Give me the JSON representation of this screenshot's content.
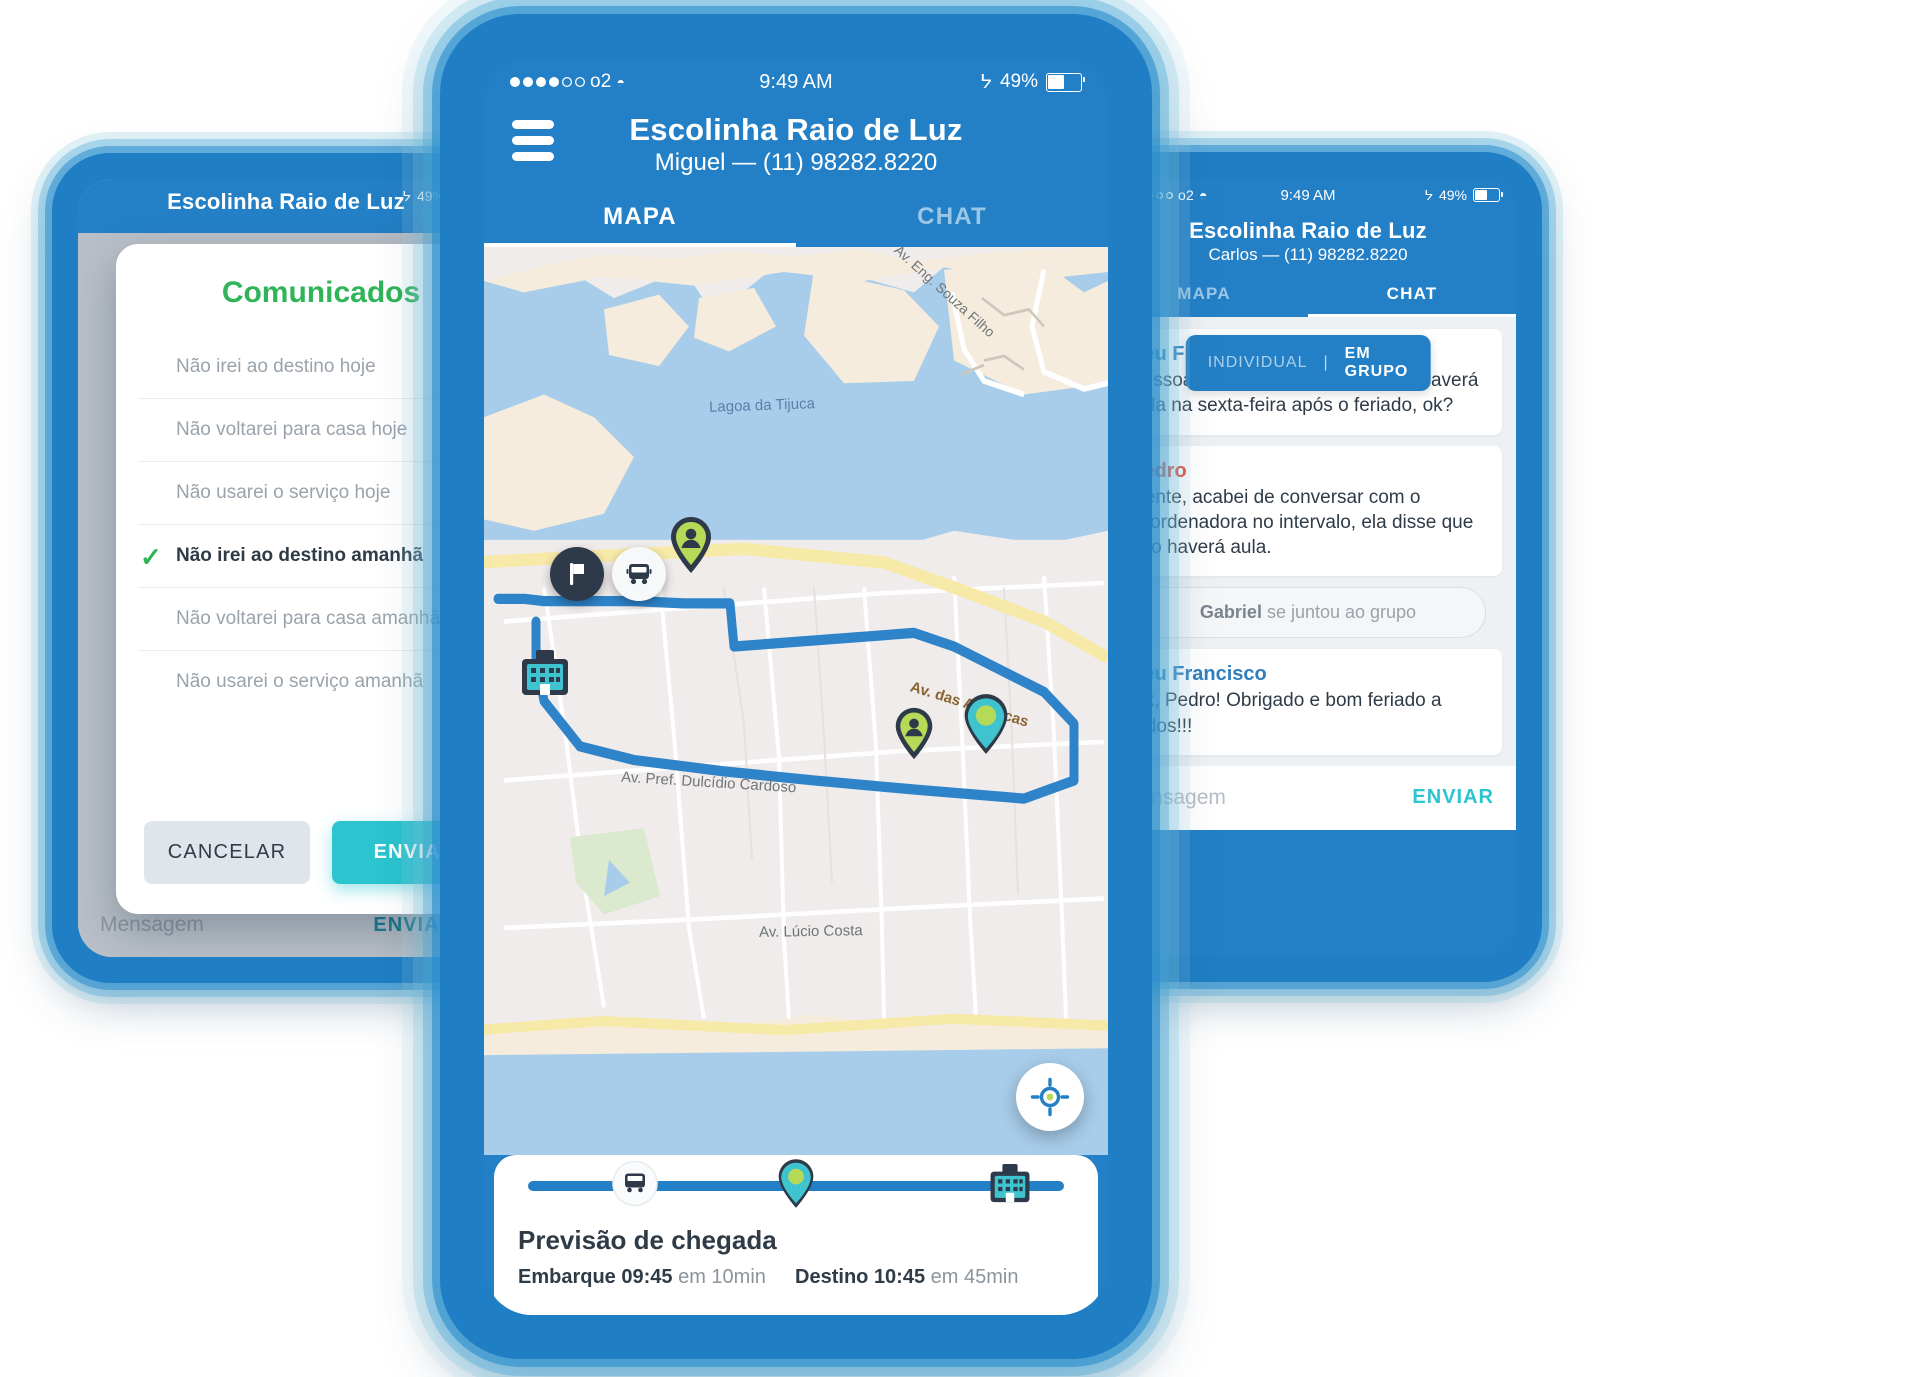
{
  "status_bar": {
    "carrier": "o2",
    "time": "9:49 AM",
    "battery_percent": "49%",
    "signal_dots_filled": 4,
    "signal_dots_total": 6,
    "wifi_icon": "wifi-icon",
    "bluetooth_icon": "bluetooth-icon",
    "battery_icon": "battery-icon"
  },
  "left_phone": {
    "ghost_header_title": "Escolinha Raio de Luz",
    "message_bar": {
      "placeholder": "Mensagem",
      "send_label": "ENVIAR",
      "menu_icon": "kebab-menu-icon"
    },
    "modal": {
      "title": "Comunicados",
      "options": [
        {
          "label": "Não irei ao destino hoje",
          "selected": false
        },
        {
          "label": "Não voltarei para casa hoje",
          "selected": false
        },
        {
          "label": "Não usarei o serviço hoje",
          "selected": false
        },
        {
          "label": "Não irei ao destino amanhã",
          "selected": true
        },
        {
          "label": "Não voltarei para casa amanhã",
          "selected": false
        },
        {
          "label": "Não usarei o serviço amanhã",
          "selected": false
        }
      ],
      "check_icon": "check-icon",
      "cancel_label": "CANCELAR",
      "send_label": "ENVIAR"
    }
  },
  "center_phone": {
    "header": {
      "title": "Escolinha Raio de Luz",
      "subtitle": "Miguel — (11) 98282.8220",
      "menu_icon": "hamburger-menu-icon"
    },
    "tabs": [
      {
        "label": "MAPA",
        "active": true
      },
      {
        "label": "CHAT",
        "active": false
      }
    ],
    "map": {
      "labels": [
        {
          "name": "Lagoa da Tijuca",
          "kind": "water"
        },
        {
          "name": "Av. Eng. Souza Filho",
          "kind": "road"
        },
        {
          "name": "Av. das Américas",
          "kind": "highway"
        },
        {
          "name": "Av. Pref. Dulcídio Cardoso",
          "kind": "road"
        },
        {
          "name": "Av. Lúcio Costa",
          "kind": "road"
        }
      ],
      "markers": [
        {
          "icon": "flag-marker-icon",
          "label": "origem"
        },
        {
          "icon": "bus-marker-icon",
          "label": "veículo"
        },
        {
          "icon": "person-pin-icon",
          "label": "passageiro"
        },
        {
          "icon": "school-building-icon",
          "label": "escola"
        },
        {
          "icon": "person-pin-icon",
          "label": "passageiro"
        },
        {
          "icon": "destination-pin-icon",
          "label": "destino"
        }
      ],
      "locate_button_icon": "crosshair-icon"
    },
    "eta": {
      "title": "Previsão de chegada",
      "boarding_label": "Embarque",
      "boarding_time": "09:45",
      "boarding_eta": "em 10min",
      "destination_label": "Destino",
      "destination_time": "10:45",
      "destination_eta": "em 45min",
      "progress_icons": [
        "bus-icon",
        "pin-icon",
        "school-icon"
      ]
    }
  },
  "right_phone": {
    "header": {
      "title": "Escolinha Raio de Luz",
      "subtitle": "Carlos — (11) 98282.8220",
      "menu_icon": "hamburger-menu-icon"
    },
    "tabs": [
      {
        "label": "MAPA",
        "active": false
      },
      {
        "label": "CHAT",
        "active": true
      }
    ],
    "segmented": {
      "individual": "INDIVIDUAL",
      "divider": "|",
      "group": "EM GRUPO",
      "active": "EM GRUPO"
    },
    "messages": [
      {
        "type": "message",
        "author": "Seu Francisco",
        "author_color": "#2e7fc0",
        "text": "Pessoal, depois me confirmem se haverá aula na sexta-feira após o feriado, ok?"
      },
      {
        "type": "message",
        "author": "Pedro",
        "author_color": "#ea4b3c",
        "text": "Gente, acabei de conversar com o coordenadora no intervalo, ela disse que não haverá aula."
      },
      {
        "type": "system",
        "author": "Gabriel",
        "text": " se juntou ao grupo"
      },
      {
        "type": "message",
        "author": "Seu Francisco",
        "author_color": "#2e7fc0",
        "text": "Ok, Pedro! Obrigado e bom feriado a todos!!!"
      }
    ],
    "message_bar": {
      "placeholder": "Mensagem",
      "send_label": "ENVIAR"
    }
  },
  "colors": {
    "brand_blue": "#2480c6",
    "accent_teal": "#2bc4cf",
    "accent_green": "#2fb457",
    "alert_red": "#ea4b3c",
    "map_water": "#a8cdea",
    "route_blue": "#2e83c9"
  }
}
